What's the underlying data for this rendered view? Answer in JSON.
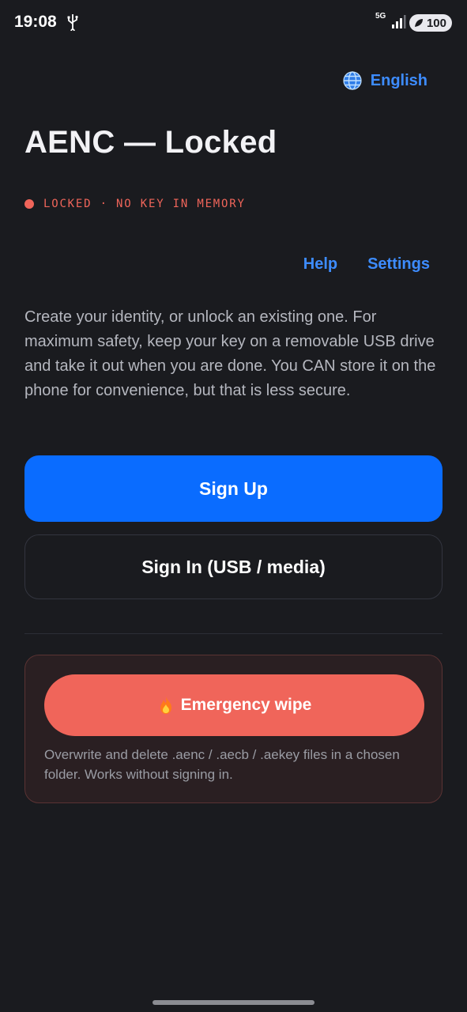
{
  "status_bar": {
    "time": "19:08",
    "network": "5G",
    "battery": "100"
  },
  "header": {
    "language_label": "English",
    "title": "AENC — Locked",
    "lock_status": "LOCKED · NO KEY IN MEMORY"
  },
  "links": {
    "help": "Help",
    "settings": "Settings"
  },
  "intro_text": "Create your identity, or unlock an existing one. For maximum safety, keep your key on a removable USB drive and take it out when you are done. You CAN store it on the phone for convenience, but that is less secure.",
  "buttons": {
    "sign_up": "Sign Up",
    "sign_in": "Sign In (USB / media)"
  },
  "emergency": {
    "wipe_label": "Emergency wipe",
    "note": "Overwrite and delete .aenc / .aecb / .aekey files in a chosen folder. Works without signing in."
  },
  "colors": {
    "background": "#1a1b1f",
    "accent": "#0a6cff",
    "link": "#3d8cff",
    "danger": "#f0655a"
  },
  "icons": [
    "usb-icon",
    "signal-icon",
    "battery-icon",
    "globe-icon",
    "fire-icon"
  ]
}
